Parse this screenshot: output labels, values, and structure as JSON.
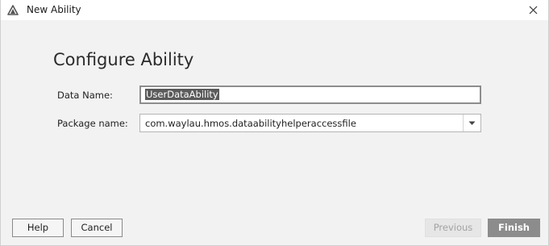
{
  "window": {
    "title": "New Ability",
    "icon": "huawei-devstudio-logo-icon",
    "close_icon": "close-icon"
  },
  "page": {
    "heading": "Configure Ability"
  },
  "form": {
    "data_name_label": "Data Name:",
    "data_name_value": "UserDataAbility",
    "package_name_label": "Package name:",
    "package_name_value": "com.waylau.hmos.dataabilityhelperaccessfile",
    "package_dropdown_icon": "chevron-down-icon"
  },
  "buttons": {
    "help": "Help",
    "cancel": "Cancel",
    "previous": "Previous",
    "finish": "Finish"
  },
  "colors": {
    "selection_bg": "#5a5a5a",
    "finish_bg": "#8c8c8c",
    "disabled_bg": "#e6e6e6"
  }
}
